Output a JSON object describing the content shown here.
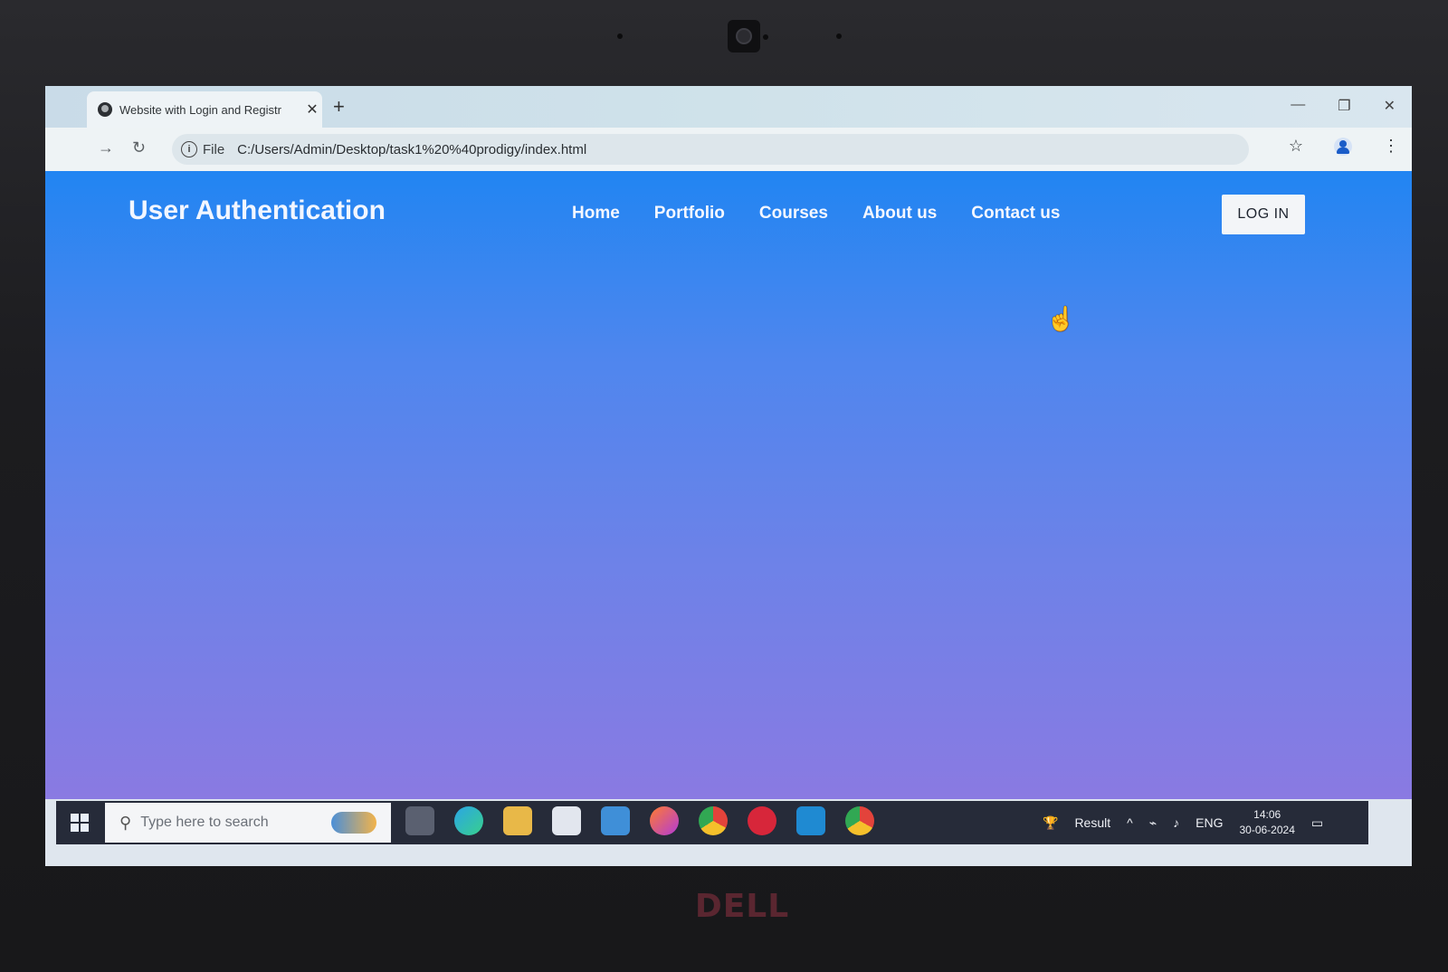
{
  "browser": {
    "tab_title": "Website with Login and Registr",
    "tab_close": "✕",
    "new_tab": "+",
    "scheme_label": "File",
    "url": "C:/Users/Admin/Desktop/task1%20%40prodigy/index.html",
    "window_min": "—",
    "window_restore": "❐",
    "window_close": "✕"
  },
  "site": {
    "title": "User Authentication",
    "nav": [
      "Home",
      "Portfolio",
      "Courses",
      "About us",
      "Contact us"
    ],
    "login_label": "LOG IN"
  },
  "taskbar": {
    "search_placeholder": "Type here to search",
    "tray_app": "Result",
    "language": "ENG",
    "time": "14:06",
    "date": "30-06-2024"
  },
  "device_brand": "DELL",
  "colors": {
    "page_gradient_top": "#2185f2",
    "page_gradient_bottom": "#8a7ae2",
    "taskbar": "#262b39"
  }
}
